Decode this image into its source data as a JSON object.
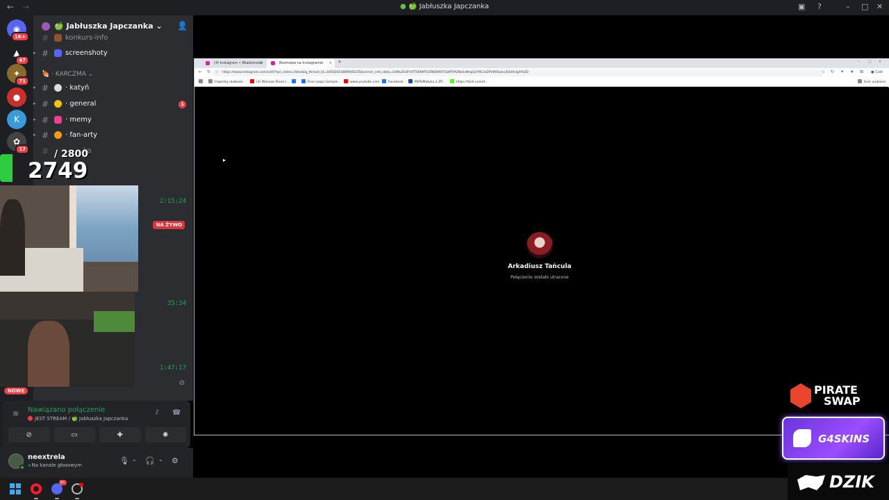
{
  "window": {
    "title": "Jabłuszka Japczanka"
  },
  "servers": [
    {
      "badge": "1K+"
    },
    {
      "badge": "47"
    },
    {
      "badge": "71"
    },
    {
      "badge": ""
    },
    {
      "badge": ""
    },
    {
      "badge": "17"
    }
  ],
  "guild": {
    "name": "Jabłuszka Japczanka",
    "channels_top": [
      {
        "name": "konkurs-info"
      },
      {
        "name": "screenshoty"
      }
    ],
    "category": "KARCZMA",
    "channels": [
      {
        "name": "katyń",
        "unread": ""
      },
      {
        "name": "general",
        "unread": "1"
      },
      {
        "name": "memy",
        "unread": ""
      },
      {
        "name": "fan-arty",
        "unread": ""
      },
      {
        "name": "ko",
        "unread": ""
      }
    ],
    "voice_times": [
      "2:15:24",
      "35:34",
      "1:47:17"
    ],
    "live_badge": "NA ŻYWO",
    "new_badge": "NOWE"
  },
  "overlay_counter": {
    "goal": "/ 2800",
    "current": "2749"
  },
  "rtc": {
    "status": "Nawiązano połączenie",
    "channel": "JEST STREAM / 🍏 Jabłuszka Japczanka"
  },
  "user": {
    "name": "neextrela",
    "status": "Na kanale głosowym"
  },
  "browser": {
    "tabs": [
      {
        "label": "(4) Instagram • Wiadomości"
      },
      {
        "label": "Rozmowa na Instagramie"
      }
    ],
    "url": "https://www.instagram.com/call/?has_video=false&ig_thread_id=18502833889046255&server_info_data=GANvZG4YVFT006MTU2ND09OTQzMTM2NzkxNhgQcFRCckZPVW5kakcjS5dXUgA%3D",
    "bookmarks": [
      {
        "label": "Importuj ulubione",
        "color": "#888888"
      },
      {
        "label": "(1) Warsaw Shore I...",
        "color": "#ff0000"
      },
      {
        "label": "",
        "color": "#1877f2"
      },
      {
        "label": "Free Loops Sample...",
        "color": "#1877f2"
      },
      {
        "label": "www.youtube.com",
        "color": "#ff0000"
      },
      {
        "label": "Facebook",
        "color": "#1877f2"
      },
      {
        "label": "MATeMatyka 2 ZP...",
        "color": "#1a4f9c"
      },
      {
        "label": "https://kick.com/d...",
        "color": "#53fc18"
      }
    ],
    "other_bookmarks": "Inne ulubione",
    "sidebar_label": "Czat"
  },
  "call": {
    "name": "Arkadiusz Tańcula",
    "status": "Połączenie zostało utracone"
  },
  "sponsors": {
    "pirate_line1": "PIRATE",
    "pirate_line2": "SWAP",
    "g4skins": "G4SKINS",
    "dzik": "DZIK"
  },
  "taskbar": {
    "discord_badge": "9+"
  }
}
